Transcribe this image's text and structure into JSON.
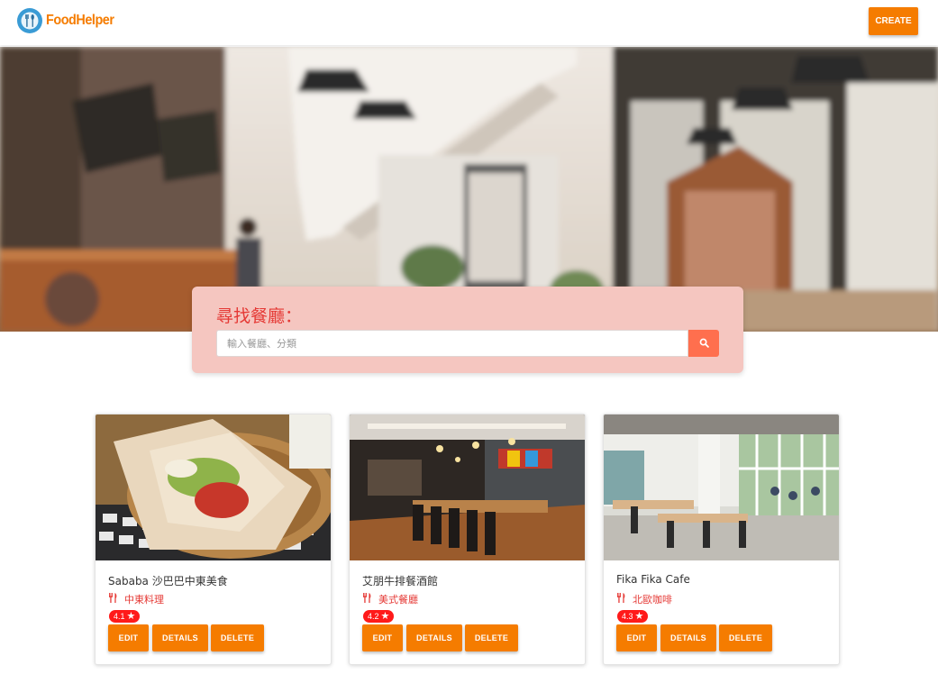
{
  "navbar": {
    "brand": "FoodHelper",
    "create_label": "CREATE"
  },
  "search": {
    "title": "尋找餐廳：",
    "placeholder": "輸入餐廳、分類"
  },
  "restaurants": [
    {
      "name": "Sababa 沙巴巴中東美食",
      "category": "中東料理",
      "rating": "4.1",
      "edit_label": "EDIT",
      "details_label": "DETAILS",
      "delete_label": "DELETE"
    },
    {
      "name": "艾朋牛排餐酒館",
      "category": "美式餐廳",
      "rating": "4.2",
      "edit_label": "EDIT",
      "details_label": "DETAILS",
      "delete_label": "DELETE"
    },
    {
      "name": "Fika Fika Cafe",
      "category": "北歐咖啡",
      "rating": "4.3",
      "edit_label": "EDIT",
      "details_label": "DETAILS",
      "delete_label": "DELETE"
    }
  ],
  "colors": {
    "brand": "#f57c00",
    "accent_red": "#e53935",
    "search_panel": "#f5c6c0",
    "search_button": "#ff6f4e",
    "rating_badge": "#ff1a1a"
  },
  "icons": {
    "logo": "fork-knife-icon",
    "search": "search-icon",
    "category": "utensils-icon",
    "rating": "star-icon"
  }
}
